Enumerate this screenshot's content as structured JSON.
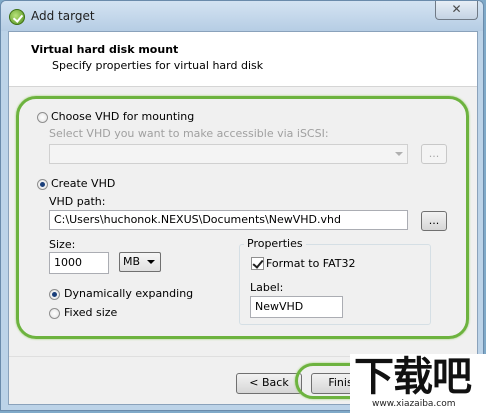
{
  "window": {
    "title": "Add target",
    "close_glyph": "✕"
  },
  "header": {
    "title": "Virtual hard disk mount",
    "subtitle": "Specify properties for virtual hard disk"
  },
  "choose_vhd": {
    "label": "Choose VHD for mounting",
    "hint": "Select VHD you want to make accessible via iSCSI:",
    "selected": false,
    "dropdown_value": "",
    "browse_label": "..."
  },
  "create_vhd": {
    "label": "Create VHD",
    "selected": true,
    "path_label": "VHD path:",
    "path_value": "C:\\Users\\huchonok.NEXUS\\Documents\\NewVHD.vhd",
    "browse_label": "...",
    "size_label": "Size:",
    "size_value": "1000",
    "unit_value": "MB",
    "dynamic_label": "Dynamically expanding",
    "dynamic_selected": true,
    "fixed_label": "Fixed size",
    "fixed_selected": false
  },
  "properties": {
    "title": "Properties",
    "format_label": "Format to FAT32",
    "format_checked": true,
    "label_caption": "Label:",
    "label_value": "NewVHD"
  },
  "footer": {
    "back_label": "< Back",
    "finish_label": "Finish"
  },
  "watermark": {
    "main": "下载吧",
    "sub": "www.xiazaiba.com"
  },
  "colors": {
    "highlight": "#6db33f",
    "title_bar": "#bcd3e8"
  }
}
